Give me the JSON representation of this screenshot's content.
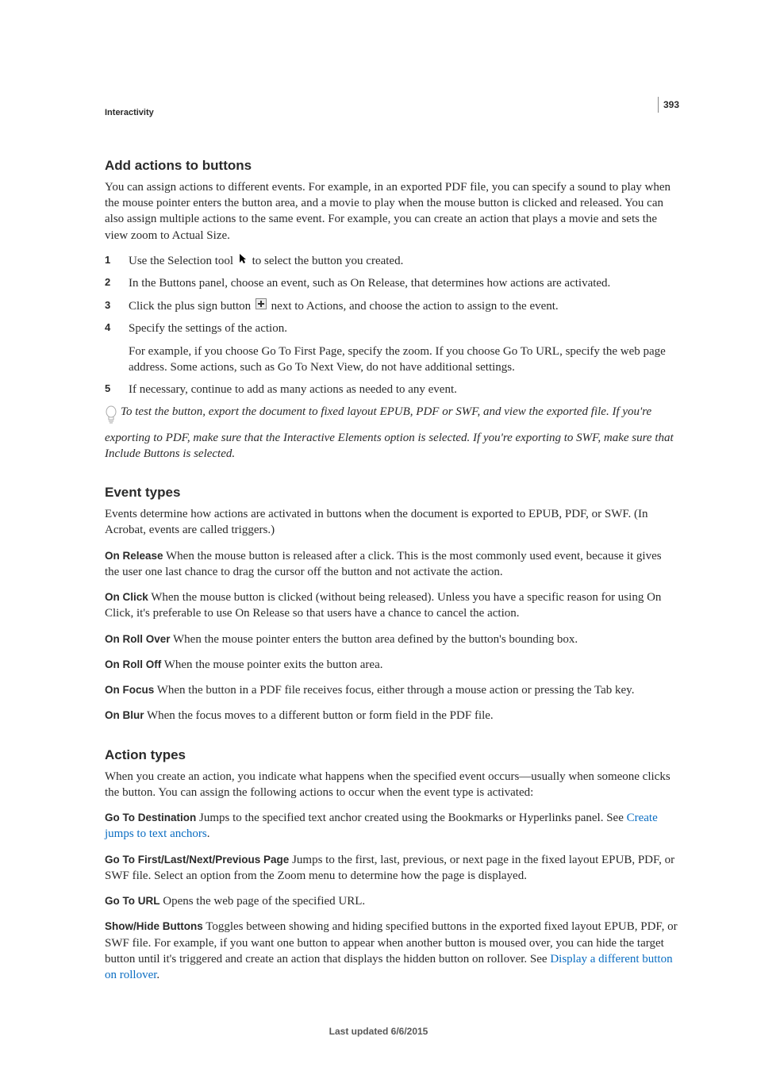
{
  "pagenum": "393",
  "section_label": "Interactivity",
  "h_add_actions": "Add actions to buttons",
  "intro_p": "You can assign actions to different events. For example, in an exported PDF file, you can specify a sound to play when the mouse pointer enters the button area, and a movie to play when the mouse button is clicked and released. You can also assign multiple actions to the same event. For example, you can create an action that plays a movie and sets the view zoom to Actual Size.",
  "steps": {
    "s1a": "Use the Selection tool ",
    "s1b": " to select the button you created.",
    "s2": "In the Buttons panel, choose an event, such as On Release, that determines how actions are activated.",
    "s3a": "Click the plus sign button ",
    "s3b": " next to Actions, and choose the action to assign to the event.",
    "s4": "Specify the settings of the action.",
    "s4_sub": "For example, if you choose Go To First Page, specify the zoom. If you choose Go To URL, specify the web page address. Some actions, such as Go To Next View, do not have additional settings.",
    "s5": "If necessary, continue to add as many actions as needed to any event."
  },
  "tip_text": "To test the button, export the document to fixed layout EPUB, PDF or SWF, and view the exported file. If you're exporting to PDF, make sure that the Interactive Elements option is selected. If you're exporting to SWF, make sure that Include Buttons is selected.",
  "h_event_types": "Event types",
  "event_intro": "Events determine how actions are activated in buttons when the document is exported to EPUB, PDF, or SWF. (In Acrobat, events are called triggers.)",
  "events": {
    "on_release": {
      "term": "On Release",
      "desc": "  When the mouse button is released after a click. This is the most commonly used event, because it gives the user one last chance to drag the cursor off the button and not activate the action."
    },
    "on_click": {
      "term": "On Click",
      "desc": "  When the mouse button is clicked (without being released). Unless you have a specific reason for using On Click, it's preferable to use On Release so that users have a chance to cancel the action."
    },
    "on_rollover": {
      "term": "On Roll Over",
      "desc": "  When the mouse pointer enters the button area defined by the button's bounding box."
    },
    "on_rolloff": {
      "term": "On Roll Off",
      "desc": "  When the mouse pointer exits the button area."
    },
    "on_focus": {
      "term": "On Focus",
      "desc": "  When the button in a PDF file receives focus, either through a mouse action or pressing the Tab key."
    },
    "on_blur": {
      "term": "On Blur",
      "desc": "  When the focus moves to a different button or form field in the PDF file."
    }
  },
  "h_action_types": "Action types",
  "action_intro": "When you create an action, you indicate what happens when the specified event occurs—usually when someone clicks the button. You can assign the following actions to occur when the event type is activated:",
  "actions": {
    "goto_dest": {
      "term": "Go To Destination",
      "desc1": "  Jumps to the specified text anchor created using the Bookmarks or Hyperlinks panel. See ",
      "link": "Create jumps to text anchors",
      "desc2": "."
    },
    "goto_page": {
      "term": "Go To First/Last/Next/Previous Page",
      "desc": "  Jumps to the first, last, previous, or next page in the fixed layout EPUB, PDF, or SWF file. Select an option from the Zoom menu to determine how the page is displayed."
    },
    "goto_url": {
      "term": "Go To URL",
      "desc": "  Opens the web page of the specified URL."
    },
    "show_hide": {
      "term": "Show/Hide Buttons",
      "desc1": "  Toggles between showing and hiding specified buttons in the exported fixed layout EPUB, PDF, or SWF file. For example, if you want one button to appear when another button is moused over, you can hide the target button until it's triggered and create an action that displays the hidden button on rollover. See ",
      "link": "Display a different button on rollover",
      "desc2": "."
    }
  },
  "footer": "Last updated 6/6/2015"
}
